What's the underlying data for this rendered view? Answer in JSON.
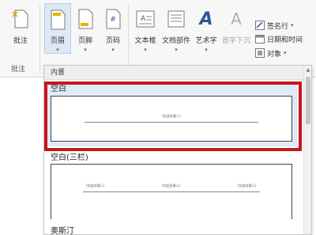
{
  "ribbon": {
    "comment_group": {
      "button_label": "批注",
      "group_label": "批注"
    },
    "header_footer_group": {
      "header_label": "页眉",
      "footer_label": "页脚",
      "page_number_label": "页码",
      "page_number_glyph": "#"
    },
    "text_group": {
      "textbox_label": "文本框",
      "quickparts_label": "文档部件",
      "wordart_label": "艺术字",
      "wordart_glyph": "A",
      "dropcap_label": "首字下沉",
      "dropcap_glyph": "A",
      "signature_label": "签名行",
      "datetime_label": "日期和时间",
      "object_label": "对象"
    }
  },
  "gallery": {
    "section_header": "内置",
    "items": [
      {
        "title": "空白",
        "placeholder": "[在此处键入]",
        "selected": true
      },
      {
        "title": "空白(三栏)",
        "placeholders": [
          "[在此处键入]",
          "[在此处键入]",
          "[在此处键入]"
        ]
      },
      {
        "title": "奥斯汀"
      }
    ]
  },
  "colors": {
    "selection": "#c8151b",
    "active_button": "#dde8f6",
    "wordart_blue": "#2b5797",
    "signature_blue": "#2b5797"
  }
}
